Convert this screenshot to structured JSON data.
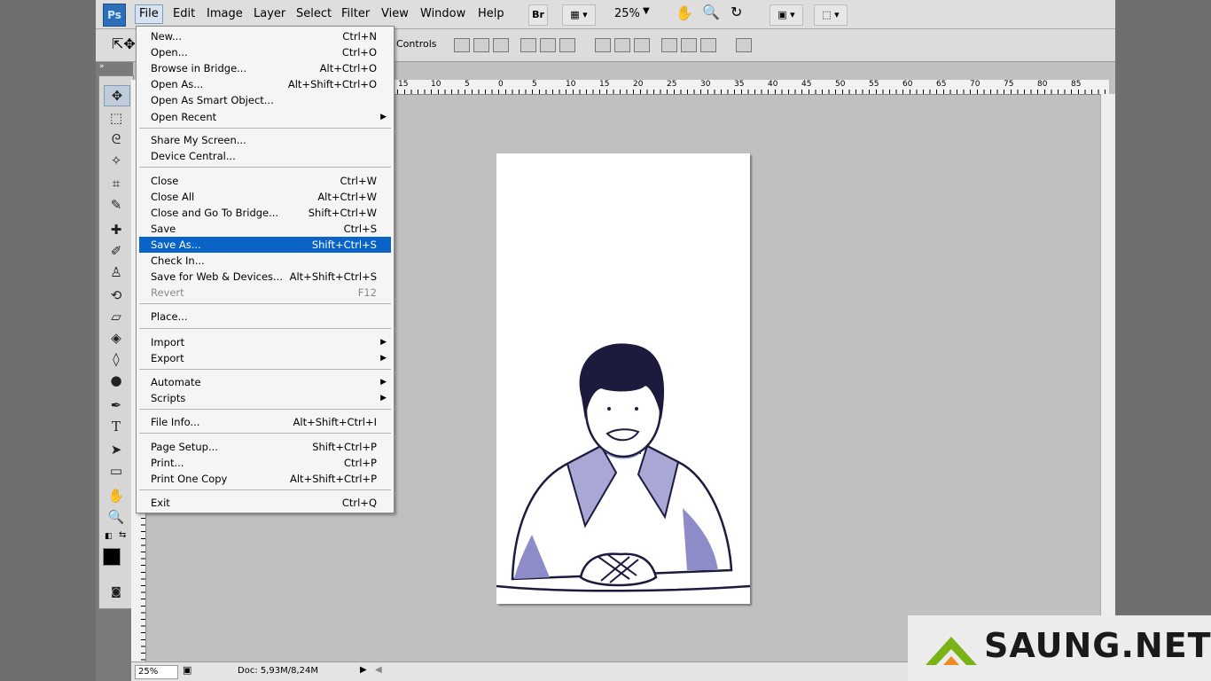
{
  "app": {
    "logo": "Ps"
  },
  "menubar": {
    "items": [
      "File",
      "Edit",
      "Image",
      "Layer",
      "Select",
      "Filter",
      "View",
      "Window",
      "Help"
    ],
    "bridge_button": "Br",
    "zoom": "25%"
  },
  "options": {
    "controls_label": "Controls"
  },
  "ruler": {
    "ticks": [
      "15",
      "10",
      "5",
      "0",
      "5",
      "10",
      "15",
      "20",
      "25",
      "30",
      "35",
      "40",
      "45",
      "50",
      "55",
      "60",
      "65",
      "70",
      "75",
      "80",
      "85"
    ]
  },
  "file_menu": {
    "groups": [
      [
        {
          "label": "New...",
          "shortcut": "Ctrl+N"
        },
        {
          "label": "Open...",
          "shortcut": "Ctrl+O"
        },
        {
          "label": "Browse in Bridge...",
          "shortcut": "Alt+Ctrl+O"
        },
        {
          "label": "Open As...",
          "shortcut": "Alt+Shift+Ctrl+O"
        },
        {
          "label": "Open As Smart Object...",
          "shortcut": ""
        },
        {
          "label": "Open Recent",
          "shortcut": "",
          "submenu": true
        }
      ],
      [
        {
          "label": "Share My Screen...",
          "shortcut": ""
        },
        {
          "label": "Device Central...",
          "shortcut": ""
        }
      ],
      [
        {
          "label": "Close",
          "shortcut": "Ctrl+W"
        },
        {
          "label": "Close All",
          "shortcut": "Alt+Ctrl+W"
        },
        {
          "label": "Close and Go To Bridge...",
          "shortcut": "Shift+Ctrl+W"
        },
        {
          "label": "Save",
          "shortcut": "Ctrl+S"
        },
        {
          "label": "Save As...",
          "shortcut": "Shift+Ctrl+S",
          "highlighted": true
        },
        {
          "label": "Check In...",
          "shortcut": ""
        },
        {
          "label": "Save for Web & Devices...",
          "shortcut": "Alt+Shift+Ctrl+S"
        },
        {
          "label": "Revert",
          "shortcut": "F12",
          "disabled": true
        }
      ],
      [
        {
          "label": "Place...",
          "shortcut": ""
        }
      ],
      [
        {
          "label": "Import",
          "shortcut": "",
          "submenu": true
        },
        {
          "label": "Export",
          "shortcut": "",
          "submenu": true
        }
      ],
      [
        {
          "label": "Automate",
          "shortcut": "",
          "submenu": true
        },
        {
          "label": "Scripts",
          "shortcut": "",
          "submenu": true
        }
      ],
      [
        {
          "label": "File Info...",
          "shortcut": "Alt+Shift+Ctrl+I"
        }
      ],
      [
        {
          "label": "Page Setup...",
          "shortcut": "Shift+Ctrl+P"
        },
        {
          "label": "Print...",
          "shortcut": "Ctrl+P"
        },
        {
          "label": "Print One Copy",
          "shortcut": "Alt+Shift+Ctrl+P"
        }
      ],
      [
        {
          "label": "Exit",
          "shortcut": "Ctrl+Q"
        }
      ]
    ]
  },
  "status": {
    "zoom": "25%",
    "doc": "Doc: 5,93M/8,24M"
  },
  "watermark": {
    "text": "SAUNG.NET"
  },
  "colors": {
    "highlight": "#0a64c8",
    "accent": "#2c6fb8",
    "logo_green": "#7ab317",
    "logo_orange": "#f08a24"
  }
}
